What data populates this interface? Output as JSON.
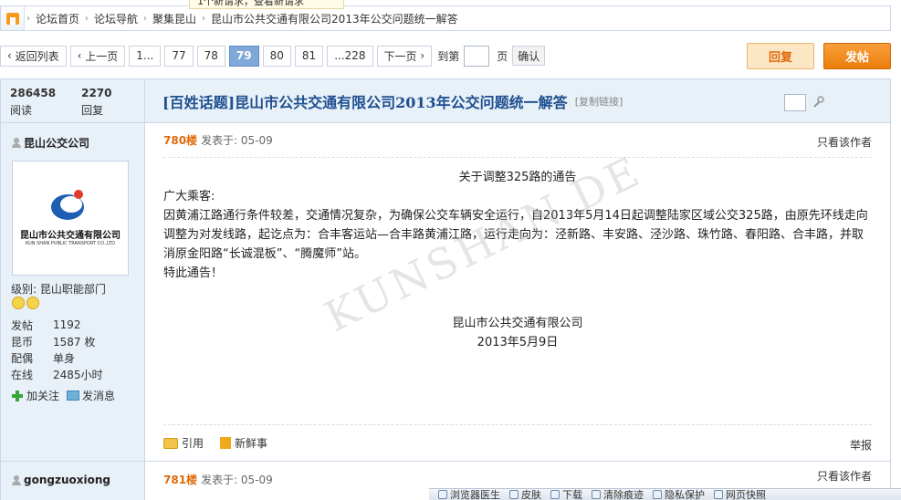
{
  "notice": {
    "text": "1个新请求，查看新请求"
  },
  "breadcrumb": {
    "items": [
      "论坛首页",
      "论坛导航",
      "聚集昆山",
      "昆山市公共交通有限公司2013年公交问题统一解答"
    ]
  },
  "pager": {
    "back_list": "返回列表",
    "prev": "上一页",
    "pages": [
      "1...",
      "77",
      "78",
      "79",
      "80",
      "81",
      "...228"
    ],
    "current": "79",
    "next": "下一页",
    "goto_label": "到第",
    "page_unit": "页",
    "confirm": "确认"
  },
  "buttons": {
    "reply": "回复",
    "post": "发帖"
  },
  "stats": {
    "views": "286458",
    "views_label": "阅读",
    "replies": "2270",
    "replies_label": "回复"
  },
  "thread": {
    "title": "[百姓话题]昆山市公共交通有限公司2013年公交问题统一解答",
    "copy_link": "[复制链接]"
  },
  "author": {
    "name": "昆山公交公司",
    "avatar_name": "昆山市公共交通有限公司",
    "avatar_en": "KUN SHAN PUBLIC TRANSPORT CO.,LTD",
    "level_label": "级别:",
    "level": "昆山职能部门",
    "info": [
      {
        "k": "发帖",
        "v": "1192"
      },
      {
        "k": "昆币",
        "v": "1587 枚"
      },
      {
        "k": "配偶",
        "v": "单身"
      },
      {
        "k": "在线",
        "v": "2485小时"
      }
    ],
    "follow": "加关注",
    "message": "发消息"
  },
  "post": {
    "floor": "780楼",
    "posted": "发表于: 05-09",
    "only_author": "只看该作者",
    "notice_title": "关于调整325路的通告",
    "greeting": "广大乘客:",
    "paragraph": "因黄浦江路通行条件较差，交通情况复杂，为确保公交车辆安全运行，自2013年5月14日起调整陆家区域公交325路，由原先环线走向调整为对发线路，起讫点为：合丰客运站—合丰路黄浦江路，运行走向为：泾新路、丰安路、泾沙路、珠竹路、春阳路、合丰路，并取消原金阳路“长诚混板”、“腾魔师”站。",
    "closing": "特此通告！",
    "sign_org": "昆山市公共交通有限公司",
    "sign_date": "2013年5月9日",
    "quote": "引用",
    "news": "新鲜事",
    "report": "举报"
  },
  "next_post": {
    "author": "gongzuoxiong",
    "floor": "781楼",
    "posted": "发表于: 05-09",
    "only_author": "只看该作者"
  },
  "watermark": "KUNSHAN.DE",
  "statusbar": [
    "浏览器医生",
    "皮肤",
    "下载",
    "清除痕迹",
    "隐私保护",
    "网页快照"
  ]
}
